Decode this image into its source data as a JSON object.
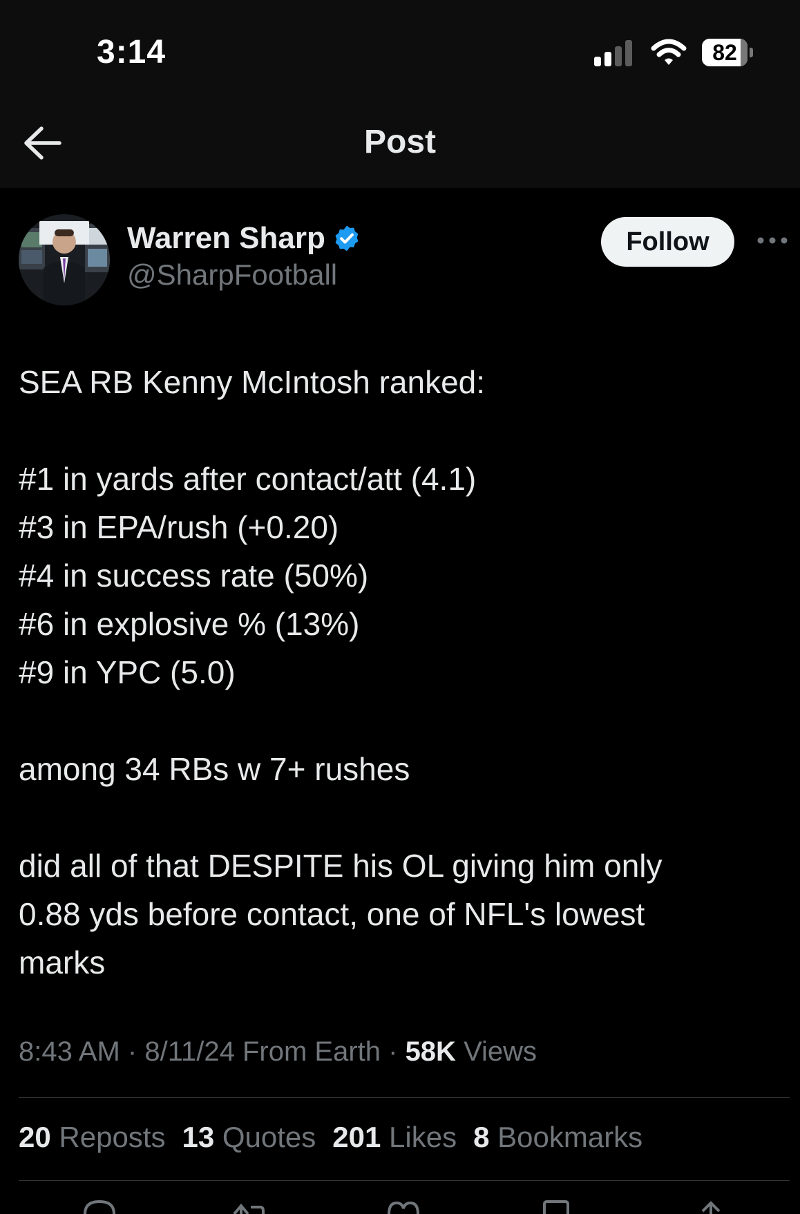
{
  "status_bar": {
    "time": "3:14",
    "battery": "82"
  },
  "nav": {
    "title": "Post"
  },
  "author": {
    "name": "Warren Sharp",
    "handle": "@SharpFootball",
    "verified": true,
    "follow_label": "Follow"
  },
  "post": {
    "lines": [
      "SEA RB Kenny McIntosh ranked:",
      "",
      "#1 in yards after contact/att (4.1)",
      "#3 in EPA/rush (+0.20)",
      "#4 in success rate (50%)",
      "#6 in explosive % (13%)",
      "#9 in YPC (5.0)",
      "",
      "among 34 RBs w 7+ rushes",
      "",
      "did all of that DESPITE his OL giving him only",
      "0.88 yds before contact, one of NFL's lowest",
      "marks"
    ],
    "time": "8:43 AM",
    "date": "8/11/24",
    "source": "From Earth",
    "views_count": "58K",
    "views_label": "Views"
  },
  "stats": [
    {
      "count": "20",
      "label": "Reposts"
    },
    {
      "count": "13",
      "label": "Quotes"
    },
    {
      "count": "201",
      "label": "Likes"
    },
    {
      "count": "8",
      "label": "Bookmarks"
    }
  ],
  "colors": {
    "background": "#000000",
    "header": "#0d0d0d",
    "text": "#e7e9ea",
    "muted": "#71767b",
    "verified": "#1d9bf0",
    "divider": "#2f3336"
  },
  "icons": {
    "back": "arrow-left-icon",
    "verified": "verified-badge-icon",
    "more": "more-horizontal-icon",
    "actions": [
      "reply-icon",
      "repost-icon",
      "like-icon",
      "bookmark-icon",
      "share-icon"
    ]
  }
}
